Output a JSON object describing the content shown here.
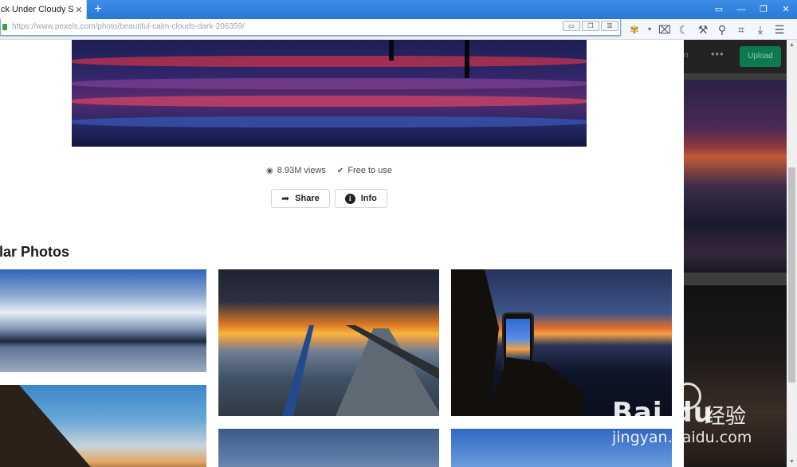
{
  "browser": {
    "tab": {
      "title": "ck Under Cloudy Sky",
      "close": "✕"
    },
    "new_tab": "+",
    "window_controls": {
      "sidebar": "▭",
      "minimize": "—",
      "restore": "❐",
      "close": "✕"
    },
    "url": "https://www.pexels.com/photo/beautiful-calm-clouds-dark-206359/",
    "url_controls": {
      "minimize": "▭",
      "restore": "❐",
      "close": "⛝"
    },
    "toolbar_icons": [
      "extension-icon",
      "dropdown-icon",
      "camera-icon",
      "night-mode-icon",
      "tools-icon",
      "search-icon",
      "crop-icon",
      "download-icon",
      "menu-icon"
    ]
  },
  "photo": {
    "views": "8.93M views",
    "license": "Free to use",
    "share_label": "Share",
    "info_label": "Info"
  },
  "similar": {
    "title": "milar Photos"
  },
  "side_panel": {
    "sign_in": "n",
    "more": "•••",
    "upload_label": "Upload"
  },
  "watermark": {
    "brand": "Bai  du",
    "cn": "经验",
    "url": "jingyan.baidu.com"
  },
  "colors": {
    "tabbar": "#2a77d6",
    "upload": "#0b7a4e",
    "panel": "#1e1e1e"
  }
}
